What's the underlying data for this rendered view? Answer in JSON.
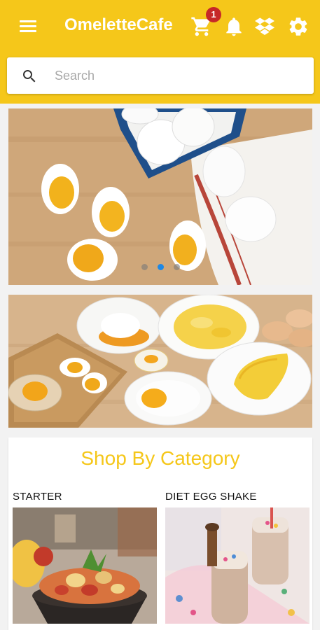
{
  "app": {
    "title": "OmeletteCafe",
    "cart_count": "1",
    "theme_color": "#f5c71a",
    "icons": [
      "menu-icon",
      "cart-icon",
      "bell-icon",
      "dropbox-icon",
      "settings-icon"
    ]
  },
  "search": {
    "placeholder": "Search"
  },
  "carousel": {
    "slide_count": 3,
    "active_index": 1
  },
  "category_section": {
    "title": "Shop By Category",
    "items": [
      {
        "label": "STARTER"
      },
      {
        "label": "DIET EGG SHAKE"
      }
    ]
  }
}
